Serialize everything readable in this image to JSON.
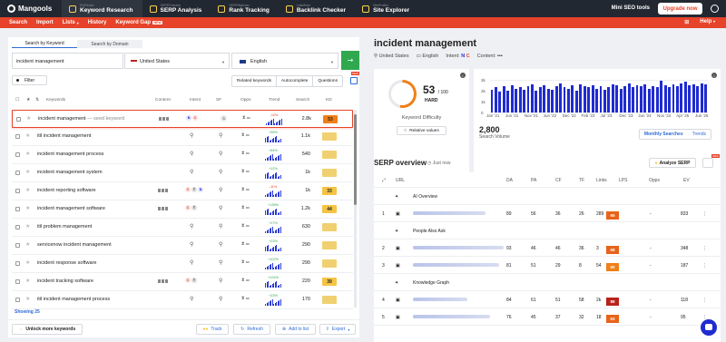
{
  "topbar": {
    "brand": "Mangools",
    "tools": [
      {
        "sub": "KWFinder",
        "name": "Keyword Research",
        "active": true
      },
      {
        "sub": "SERPChecker",
        "name": "SERP Analysis",
        "active": false
      },
      {
        "sub": "SERPWatcher",
        "name": "Rank Tracking",
        "active": false
      },
      {
        "sub": "LinkMiner",
        "name": "Backlink Checker",
        "active": false
      },
      {
        "sub": "SiteProfiler",
        "name": "Site Explorer",
        "active": false
      }
    ],
    "mini_tools": "Mini SEO tools",
    "upgrade": "Upgrade now"
  },
  "nav": {
    "items": [
      "Search",
      "Import",
      "Lists",
      "History",
      "Keyword Gap"
    ],
    "new_badge": "NEW",
    "right": [
      "Help"
    ]
  },
  "search": {
    "tabs": [
      "Search by Keyword",
      "Search by Domain"
    ],
    "keyword": "incident management",
    "country": "United States",
    "language": "English",
    "go": "→"
  },
  "filters": {
    "filter_label": "Filter",
    "tabs": [
      "Related keywords",
      "Autocomplete",
      "Questions"
    ],
    "new_badge": "NEW"
  },
  "table": {
    "headers": [
      "Keywords",
      "Content",
      "Intent",
      "SF",
      "Opps",
      "Trend",
      "Search",
      "KD"
    ],
    "rows": [
      {
        "keyword": "incident management",
        "seed": "— seed keyword",
        "intent": [
          "N",
          "C"
        ],
        "sf": "3",
        "trend": "-10%",
        "trend_color": "#e6432a",
        "search": "2.8k",
        "kd": "53",
        "kd_color": "#f07f17",
        "selected": true
      },
      {
        "keyword": "itil incident management",
        "seed": "",
        "intent": [],
        "sf": "",
        "trend": "+39%",
        "trend_color": "#2fa84f",
        "search": "1.1k",
        "kd": "",
        "kd_color": "#f0d070",
        "selected": false
      },
      {
        "keyword": "incident management process",
        "seed": "",
        "intent": [],
        "sf": "",
        "trend": "+64%",
        "trend_color": "#2fa84f",
        "search": "540",
        "kd": "",
        "kd_color": "#f0d070",
        "selected": false
      },
      {
        "keyword": "incident management system",
        "seed": "",
        "intent": [],
        "sf": "",
        "trend": "+12%",
        "trend_color": "#2fa84f",
        "search": "1k",
        "kd": "",
        "kd_color": "#f0d070",
        "selected": false
      },
      {
        "keyword": "incident reporting software",
        "seed": "",
        "intent": [
          "C",
          "T",
          "N"
        ],
        "sf": "",
        "trend": "-11%",
        "trend_color": "#e6432a",
        "search": "1k",
        "kd": "33",
        "kd_color": "#f6c443",
        "selected": false
      },
      {
        "keyword": "incident management software",
        "seed": "",
        "intent": [
          "C",
          "T"
        ],
        "sf": "",
        "trend": "+135%",
        "trend_color": "#2fa84f",
        "search": "1.2k",
        "kd": "44",
        "kd_color": "#f6c443",
        "selected": false
      },
      {
        "keyword": "itil problem management",
        "seed": "",
        "intent": [],
        "sf": "",
        "trend": "+17%",
        "trend_color": "#2fa84f",
        "search": "630",
        "kd": "",
        "kd_color": "#f0d070",
        "selected": false
      },
      {
        "keyword": "servicenow incident management",
        "seed": "",
        "intent": [],
        "sf": "",
        "trend": "+23%",
        "trend_color": "#2fa84f",
        "search": "290",
        "kd": "",
        "kd_color": "#f0d070",
        "selected": false
      },
      {
        "keyword": "incident response software",
        "seed": "",
        "intent": [],
        "sf": "",
        "trend": "+102%",
        "trend_color": "#2fa84f",
        "search": "290",
        "kd": "",
        "kd_color": "#f0d070",
        "selected": false
      },
      {
        "keyword": "incident tracking software",
        "seed": "",
        "intent": [
          "C",
          "T"
        ],
        "sf": "",
        "trend": "+124%",
        "trend_color": "#2fa84f",
        "search": "220",
        "kd": "39",
        "kd_color": "#f6c443",
        "selected": false
      },
      {
        "keyword": "itil incident management process",
        "seed": "",
        "intent": [],
        "sf": "",
        "trend": "+23%",
        "trend_color": "#2fa84f",
        "search": "170",
        "kd": "",
        "kd_color": "#f0d070",
        "selected": false
      }
    ],
    "showing": "Showing 25"
  },
  "actions": {
    "unlock": "Unlock more keywords",
    "track": "Track",
    "refresh": "Refresh",
    "add": "Add to list",
    "export": "Export"
  },
  "detail": {
    "title": "incident management",
    "country": "United States",
    "language": "English",
    "intent_label": "Intent:",
    "intent": [
      "N",
      "C"
    ],
    "content_label": "Content:",
    "kd_value": "53",
    "kd_max": "/ 100",
    "kd_word": "HARD",
    "kd_title": "Keyword Difficulty",
    "relative": "Relative values",
    "volume": "2,800",
    "volume_label": "Search Volume",
    "vtabs": [
      "Monthly Searches",
      "Trends"
    ]
  },
  "chart_data": {
    "type": "bar",
    "categories": [
      "Jan '21",
      "Jun '21",
      "Nov '21",
      "Jun '22",
      "Dec '22",
      "Feb '23",
      "Jul '23",
      "Dec '23",
      "Jun '24",
      "Nov '24",
      "Apr '25",
      "Jun '25"
    ],
    "yticks": [
      "3k",
      "2k",
      "1k",
      "0"
    ],
    "ylim": [
      0,
      3000
    ],
    "values": [
      2100,
      2300,
      1900,
      2400,
      2000,
      2500,
      2200,
      2300,
      2100,
      2400,
      2600,
      2000,
      2300,
      2500,
      2200,
      2100,
      2400,
      2700,
      2300,
      2200,
      2500,
      2000,
      2600,
      2400,
      2300,
      2500,
      2200,
      2400,
      2100,
      2300,
      2600,
      2500,
      2200,
      2400,
      2700,
      2300,
      2500,
      2400,
      2600,
      2200,
      2400,
      2300,
      2900,
      2500,
      2300,
      2600,
      2400,
      2700,
      2800,
      2500,
      2600,
      2400,
      2700,
      2600
    ]
  },
  "serp": {
    "title": "SERP overview",
    "time": "Just now",
    "analyze": "Analyze SERP",
    "headers": [
      "URL",
      "DA",
      "PA",
      "CF",
      "TF",
      "Links",
      "LPS",
      "Opps",
      "EV"
    ],
    "rows": [
      {
        "idx": "",
        "label": "AI Overview",
        "type": "section"
      },
      {
        "idx": "1",
        "da": "89",
        "pa": "56",
        "cf": "36",
        "tf": "26",
        "links": "289",
        "lps": "65",
        "lps_color": "#e8631a",
        "opps": "-",
        "ev": "833",
        "type": "result",
        "urlw": 80
      },
      {
        "idx": "",
        "label": "People Also Ask",
        "type": "section"
      },
      {
        "idx": "2",
        "da": "93",
        "pa": "46",
        "cf": "46",
        "tf": "36",
        "links": "3",
        "lps": "68",
        "lps_color": "#e8631a",
        "opps": "-",
        "ev": "348",
        "type": "result",
        "urlw": 100
      },
      {
        "idx": "3",
        "da": "81",
        "pa": "51",
        "cf": "29",
        "tf": "8",
        "links": "54",
        "lps": "50",
        "lps_color": "#f07f17",
        "opps": "-",
        "ev": "187",
        "type": "result",
        "urlw": 95
      },
      {
        "idx": "",
        "label": "Knowledge Graph",
        "type": "section"
      },
      {
        "idx": "4",
        "da": "84",
        "pa": "61",
        "cf": "51",
        "tf": "58",
        "links": "2k",
        "lps": "88",
        "lps_color": "#b9221b",
        "opps": "-",
        "ev": "118",
        "type": "result",
        "urlw": 60
      },
      {
        "idx": "5",
        "da": "76",
        "pa": "45",
        "cf": "37",
        "tf": "32",
        "links": "18",
        "lps": "63",
        "lps_color": "#e8631a",
        "opps": "-",
        "ev": "95",
        "type": "result",
        "urlw": 85
      }
    ]
  }
}
